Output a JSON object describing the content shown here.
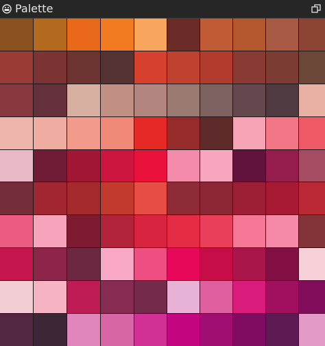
{
  "panel": {
    "title": "Palette"
  },
  "icons": {
    "panel_icon": "palette-icon",
    "float_icon": "undock-icon"
  },
  "swatches": [
    [
      "#8b521f",
      "#b46a1e",
      "#e8691a",
      "#f27b22",
      "#f8a55d",
      "#6b2c28",
      "#bf5c36",
      "#b3572e",
      "#a95a44",
      "#8c4535"
    ],
    [
      "#9a3c35",
      "#7c3333",
      "#6c3532",
      "#533433",
      "#d5412c",
      "#bf4130",
      "#b13c2d",
      "#893a33",
      "#7b3d33",
      "#6b4738"
    ],
    [
      "#893840",
      "#63303b",
      "#d7afa1",
      "#c18f84",
      "#b28580",
      "#997b74",
      "#7d625f",
      "#64484e",
      "#4e3a40",
      "#e9b1a4"
    ],
    [
      "#edb5ac",
      "#efaca0",
      "#f29b8c",
      "#ef8877",
      "#e42927",
      "#962b2b",
      "#5f2a2a",
      "#f6a4b5",
      "#f27786",
      "#ef5865"
    ],
    [
      "#e8b8c7",
      "#711c36",
      "#a11535",
      "#cc1540",
      "#e9123c",
      "#f38caa",
      "#f8a5c0",
      "#62133d",
      "#941d4e",
      "#a54c62"
    ],
    [
      "#742d39",
      "#a22532",
      "#a42a2d",
      "#c23a2d",
      "#e84d45",
      "#8d2b36",
      "#8b2634",
      "#9d1f37",
      "#a81a34",
      "#ba2735"
    ],
    [
      "#ec5c82",
      "#f7a3bc",
      "#7e1b30",
      "#b0233a",
      "#d82440",
      "#e62b44",
      "#e93f5b",
      "#f47895",
      "#f48aa7",
      "#833438"
    ],
    [
      "#c4154d",
      "#8d244a",
      "#6c2842",
      "#f7a8c7",
      "#ee4f82",
      "#e8085a",
      "#c70d47",
      "#a8164c",
      "#820f44",
      "#f6d0d6"
    ],
    [
      "#f2cdd3",
      "#f6b3c3",
      "#be1c55",
      "#862c52",
      "#742a4b",
      "#e8b2d6",
      "#e0609f",
      "#d91b7c",
      "#a1105f",
      "#820d5b"
    ],
    [
      "#522741",
      "#3b2735",
      "#e086bd",
      "#d766a7",
      "#cf3294",
      "#c3057f",
      "#a00e72",
      "#800b63",
      "#5e1a52",
      "#e39ac7"
    ]
  ]
}
